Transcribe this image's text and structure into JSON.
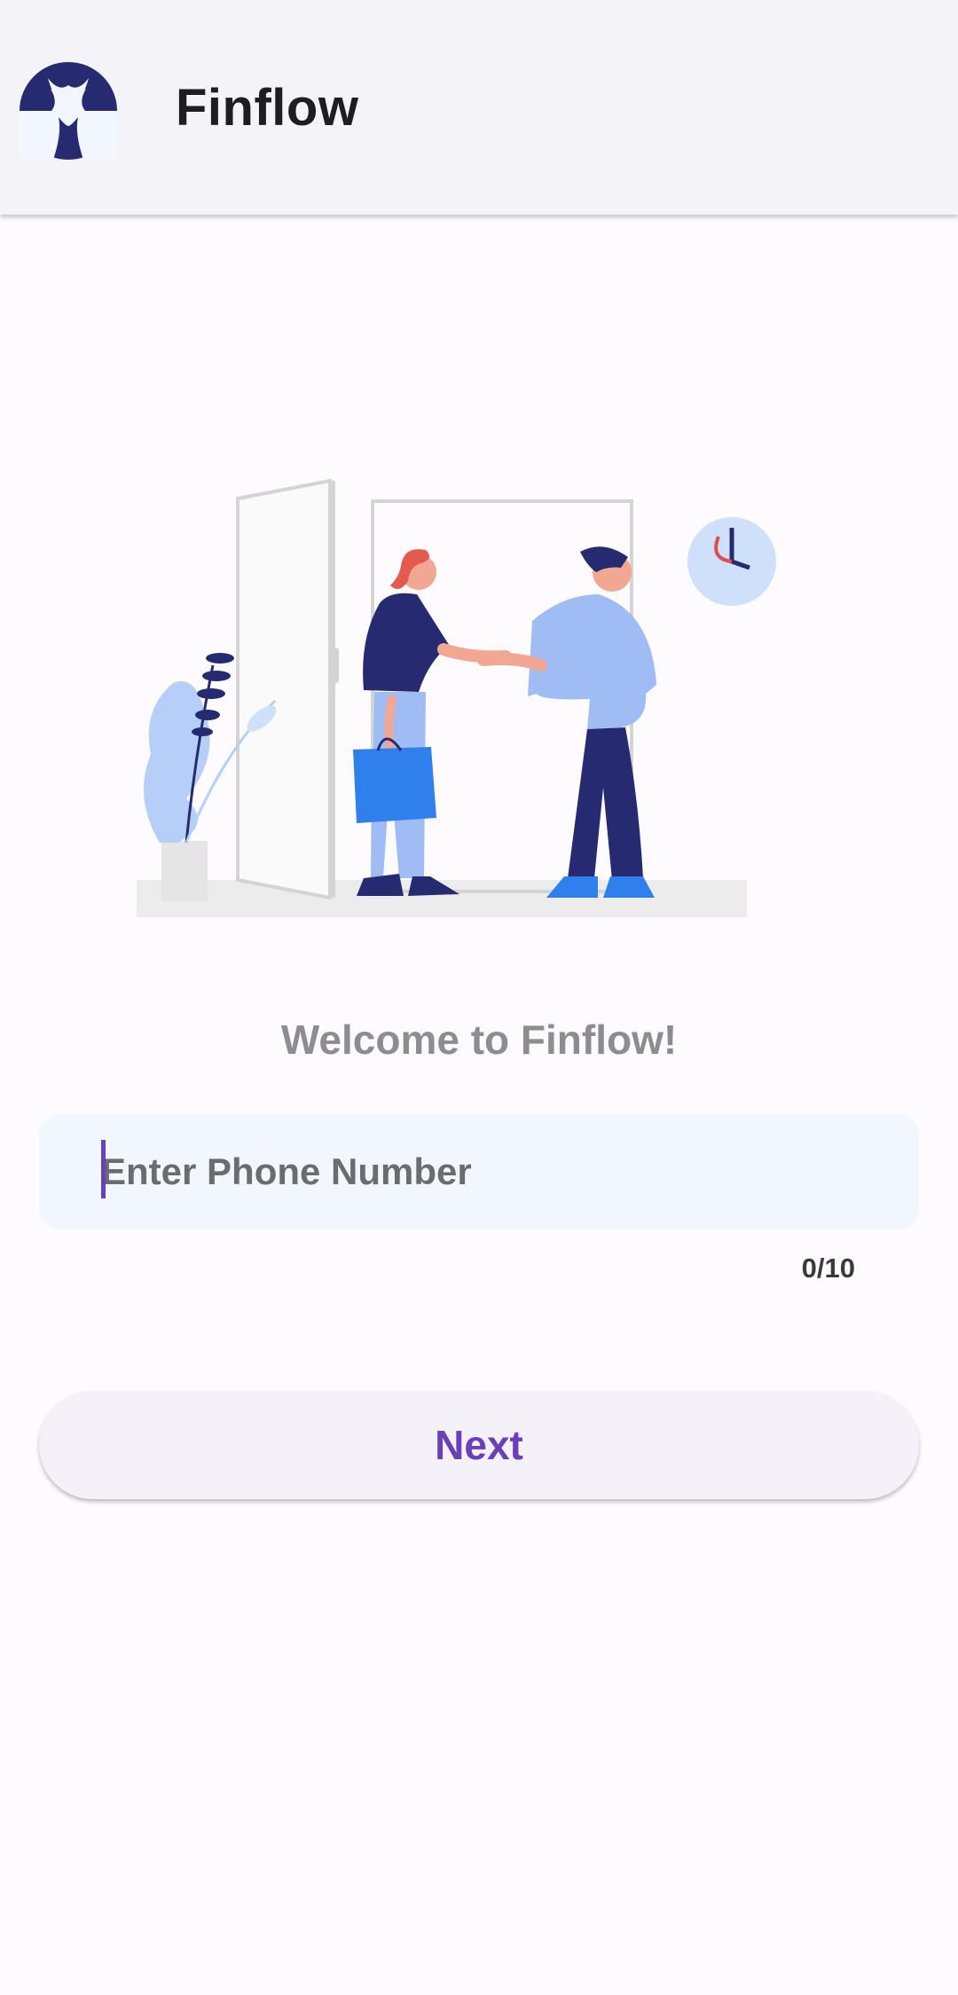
{
  "app": {
    "title": "Finflow"
  },
  "colors": {
    "appbar_bg": "#f4f3f8",
    "accent": "#6a40b8",
    "logo_navy": "#262a70",
    "input_bg": "#f1f7fc"
  },
  "main": {
    "welcome": "Welcome to Finflow!",
    "phone_input": {
      "value": "",
      "placeholder": "Enter Phone Number"
    },
    "counter": "0/10",
    "next_label": "Next"
  },
  "icons": {
    "logo": "finflow-logo-icon",
    "illustration": "welcome-handshake-illustration"
  }
}
